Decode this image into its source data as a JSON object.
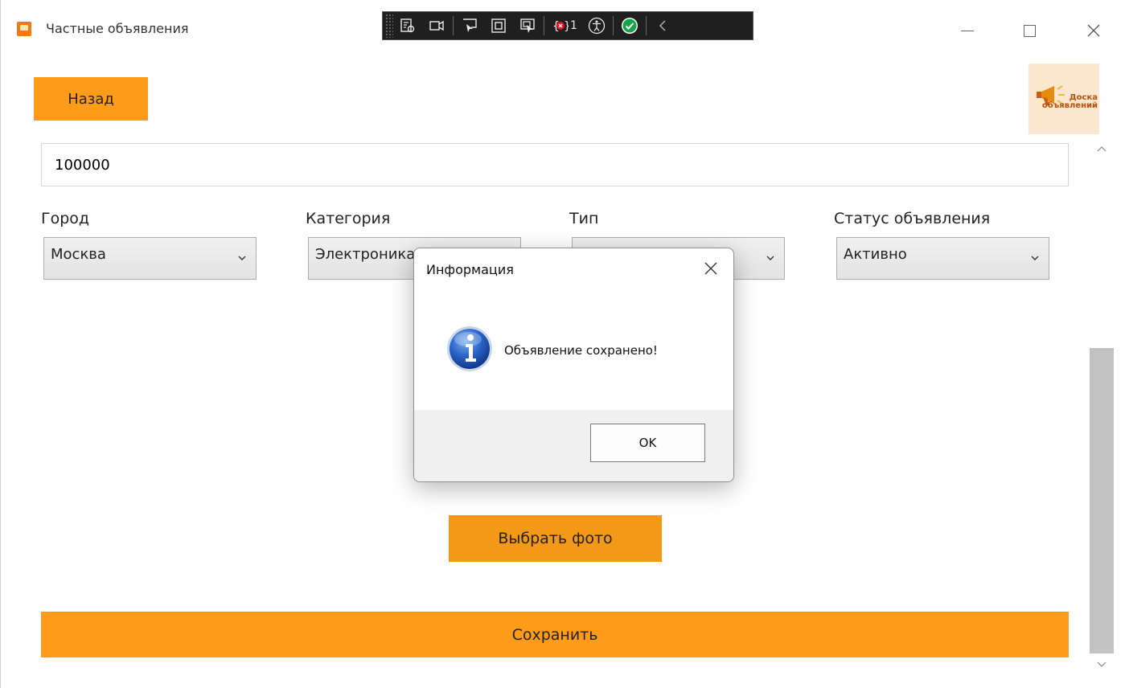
{
  "window": {
    "title": "Частные объявления"
  },
  "debug_toolbar": {
    "error_count": "1"
  },
  "nav": {
    "back_label": "Назад"
  },
  "logo": {
    "text_line1": "Доска",
    "text_line2": "объявлений"
  },
  "form": {
    "price_value": "100000",
    "city": {
      "label": "Город",
      "value": "Москва"
    },
    "category": {
      "label": "Категория",
      "value": "Электроника"
    },
    "type": {
      "label": "Тип",
      "value": ""
    },
    "status": {
      "label": "Статус объявления",
      "value": "Активно"
    },
    "select_photo_label": "Выбрать фото",
    "save_label": "Сохранить"
  },
  "dialog": {
    "title": "Информация",
    "message": "Объявление сохранено!",
    "ok_label": "OK"
  },
  "colors": {
    "accent_orange": "#fe9c19",
    "logo_bg": "#fbe6cf",
    "dialog_footer": "#f0f0f0"
  }
}
